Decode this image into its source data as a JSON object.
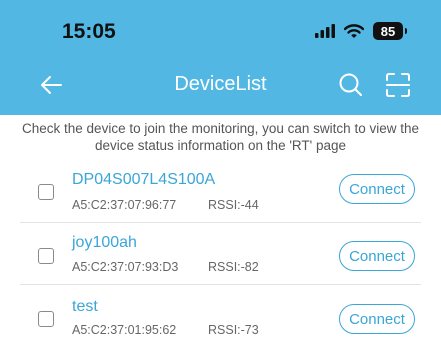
{
  "status_bar": {
    "time": "15:05",
    "battery": "85"
  },
  "header": {
    "title": "DeviceList"
  },
  "hint": "Check the device to join the monitoring, you can switch to view the device status information on the 'RT' page",
  "devices": [
    {
      "name": "DP04S007L4S100A",
      "mac": "A5:C2:37:07:96:77",
      "rssi": "RSSI:-44",
      "action": "Connect"
    },
    {
      "name": "joy100ah",
      "mac": "A5:C2:37:07:93:D3",
      "rssi": "RSSI:-82",
      "action": "Connect"
    },
    {
      "name": "test",
      "mac": "A5:C2:37:01:95:62",
      "rssi": "RSSI:-73",
      "action": "Connect"
    }
  ],
  "colors": {
    "accent": "#52b8e3",
    "link": "#3aa6d8"
  }
}
